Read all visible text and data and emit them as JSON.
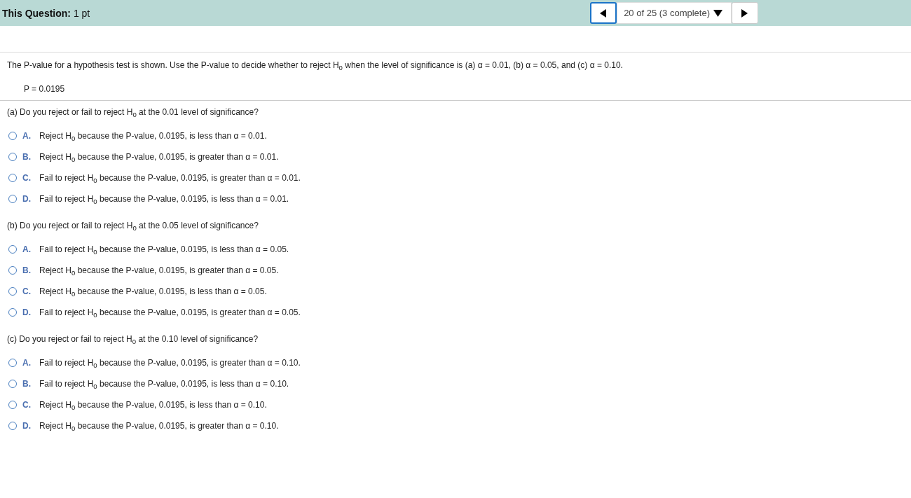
{
  "header": {
    "title": "**This Question:** 1 pt",
    "nav": {
      "position": "20 of 25 (3 complete)"
    }
  },
  "intro": "The P-value for a hypothesis test is shown. Use the P-value to decide whether to reject H$_{0}$  when the level of significance is (a) α = 0.01, (b) α = 0.05, and (c) α = 0.10.",
  "given": "P = 0.0195",
  "parts": [
    {
      "question": "(a) Do you reject or fail to reject H$_{0}$ at the 0.01 level of significance?",
      "options": [
        {
          "letter": "A.",
          "text": "Reject H$_{0}$ because the P-value, 0.0195, is less than α = 0.01.",
          "selected": false
        },
        {
          "letter": "B.",
          "text": "Reject  H$_{0}$ because the P-value, 0.0195, is greater than α = 0.01.",
          "selected": false
        },
        {
          "letter": "C.",
          "text": "Fail to reject H$_{0}$ because the P-value, 0.0195, is greater than α = 0.01.",
          "selected": false
        },
        {
          "letter": "D.",
          "text": "Fail to reject H$_{0}$ because the P-value, 0.0195, is less than α = 0.01.",
          "selected": false
        }
      ]
    },
    {
      "question": "(b) Do you reject or fail to reject H$_{0}$ at the 0.05 level of significance?",
      "options": [
        {
          "letter": "A.",
          "text": "Fail to reject H$_{0}$ because the P-value, 0.0195, is less than α = 0.05.",
          "selected": false
        },
        {
          "letter": "B.",
          "text": "Reject H$_{0}$ because the P-value, 0.0195, is greater than α = 0.05.",
          "selected": false
        },
        {
          "letter": "C.",
          "text": "Reject H$_{0}$ because the P-value, 0.0195, is less than α = 0.05.",
          "selected": false
        },
        {
          "letter": "D.",
          "text": "Fail to reject H$_{0}$ because the P-value, 0.0195, is greater than α = 0.05.",
          "selected": false
        }
      ]
    },
    {
      "question": "(c) Do you reject or fail to reject H$_{0}$ at the 0.10 level of significance?",
      "options": [
        {
          "letter": "A.",
          "text": "Fail to reject H$_{0}$ because the P-value, 0.0195, is greater than α = 0.10.",
          "selected": false
        },
        {
          "letter": "B.",
          "text": "Fail to reject H$_{0}$ because the P-value, 0.0195, is less than α = 0.10.",
          "selected": false
        },
        {
          "letter": "C.",
          "text": "Reject H$_{0}$ because the P-value, 0.0195, is less than α = 0.10.",
          "selected": false
        },
        {
          "letter": "D.",
          "text": "Reject H$_{0}$ because the P-value, 0.0195, is greater than α = 0.10.",
          "selected": false
        }
      ]
    }
  ]
}
